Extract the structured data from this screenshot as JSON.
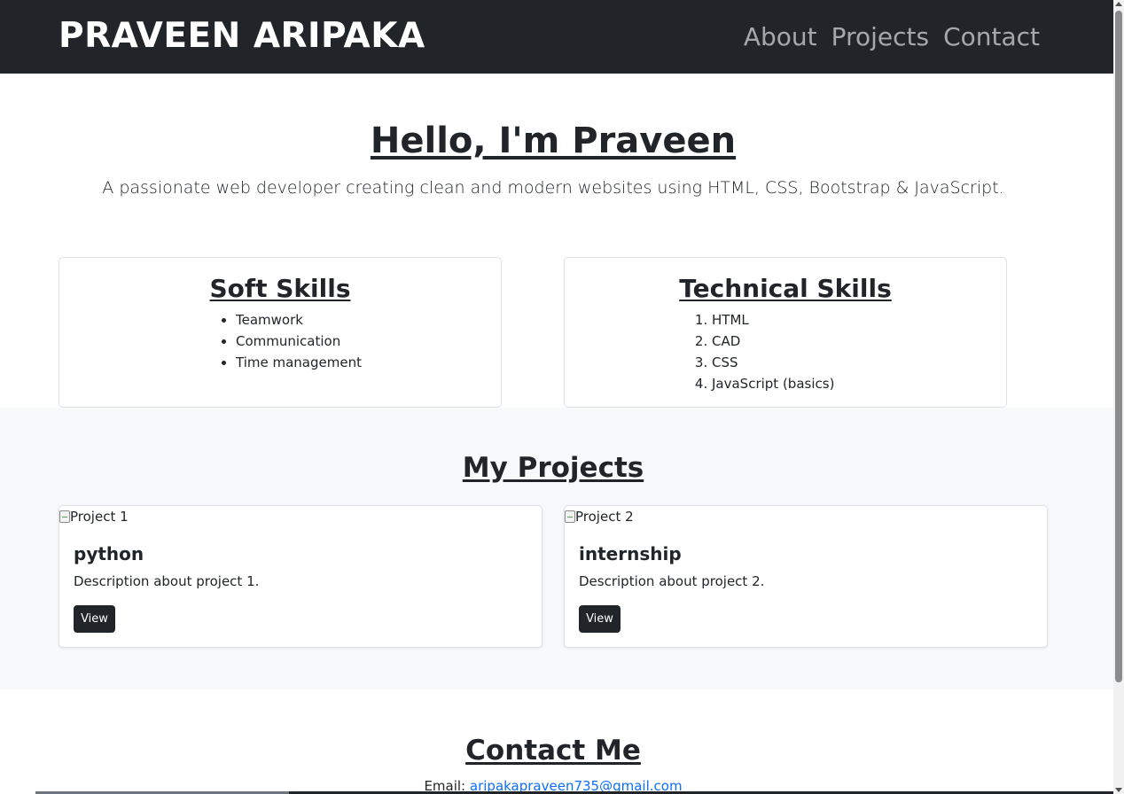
{
  "navbar": {
    "brand": "PRAVEEN ARIPAKA",
    "links": [
      "About",
      "Projects",
      "Contact"
    ]
  },
  "hero": {
    "title": "Hello, I'm Praveen",
    "subtitle": "A passionate web developer creating clean and modern websites using HTML, CSS, Bootstrap & JavaScript."
  },
  "soft_skills": {
    "title": "Soft Skills",
    "items": [
      "Teamwork",
      "Communication",
      "Time management"
    ]
  },
  "technical_skills": {
    "title": "Technical Skills",
    "items": [
      "HTML",
      "CAD",
      "CSS",
      "JavaScript (basics)"
    ]
  },
  "projects": {
    "title": "My Projects",
    "items": [
      {
        "image_alt": "Project 1",
        "name": "python",
        "description": "Description about project 1.",
        "button": "View"
      },
      {
        "image_alt": "Project 2",
        "name": "internship",
        "description": "Description about project 2.",
        "button": "View"
      }
    ]
  },
  "contact": {
    "title": "Contact Me",
    "email_label": "Email:",
    "email": "aripakapraveen735@gmail.com"
  },
  "colors": {
    "navbar_bg": "#212529",
    "section_bg": "#f8f9fa",
    "link": "#0d6efd",
    "text": "#212529"
  }
}
